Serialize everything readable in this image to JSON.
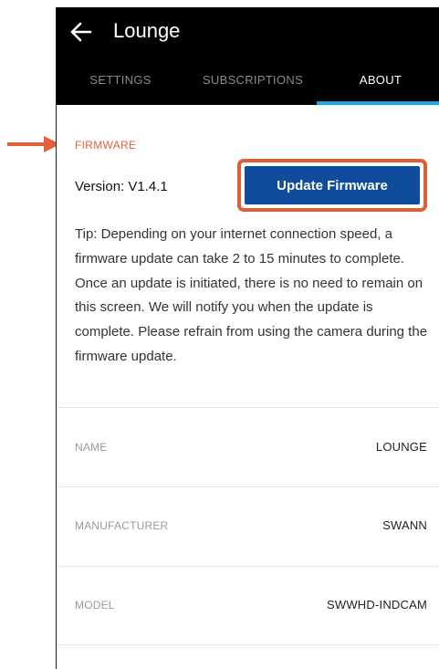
{
  "colors": {
    "appbar_bg": "#000000",
    "accent_tab": "#1aa7e3",
    "section_label": "#e5603a",
    "primary_button": "#0f4c9c",
    "annotation": "#d9603a"
  },
  "header": {
    "back_icon": "arrow-left-icon",
    "title": "Lounge"
  },
  "tabs": [
    {
      "label": "SETTINGS",
      "active": false
    },
    {
      "label": "SUBSCRIPTIONS",
      "active": false
    },
    {
      "label": "ABOUT",
      "active": true
    }
  ],
  "firmware": {
    "section_label": "FIRMWARE",
    "version_text": "Version: V1.4.1",
    "update_button_label": "Update Firmware",
    "tip": "Tip: Depending on your internet connection speed, a firmware update can take 2 to 15 minutes to complete. Once an update is initiated, there is no need to remain on this screen. We will notify you when the update is complete. Please refrain from using the camera during the firmware update."
  },
  "details": [
    {
      "label": "NAME",
      "value": "LOUNGE"
    },
    {
      "label": "MANUFACTURER",
      "value": "SWANN"
    },
    {
      "label": "MODEL",
      "value": "SWWHD-INDCAM"
    }
  ],
  "annotation": {
    "arrow_icon": "arrow-right-icon"
  }
}
